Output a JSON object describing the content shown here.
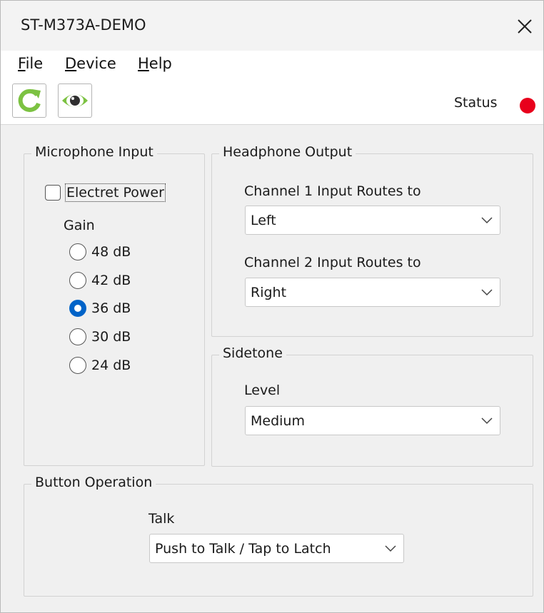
{
  "window": {
    "title": "ST-M373A-DEMO"
  },
  "menu": {
    "file": "File",
    "device": "Device",
    "help": "Help"
  },
  "toolbar": {
    "refresh_icon": "refresh-icon",
    "monitor_icon": "eye-icon",
    "status_label": "Status",
    "status_color": "#e8001c",
    "accent_green": "#7cc242"
  },
  "microphone_input": {
    "title": "Microphone Input",
    "electret_power_label": "Electret Power",
    "electret_power_checked": false,
    "gain_label": "Gain",
    "gain_options": [
      "48 dB",
      "42 dB",
      "36 dB",
      "30 dB",
      "24 dB"
    ],
    "gain_selected": "36 dB"
  },
  "headphone_output": {
    "title": "Headphone Output",
    "channel1_label": "Channel 1 Input Routes to",
    "channel1_value": "Left",
    "channel2_label": "Channel 2 Input Routes to",
    "channel2_value": "Right"
  },
  "sidetone": {
    "title": "Sidetone",
    "level_label": "Level",
    "level_value": "Medium"
  },
  "button_operation": {
    "title": "Button Operation",
    "talk_label": "Talk",
    "talk_value": "Push to Talk / Tap to Latch"
  }
}
